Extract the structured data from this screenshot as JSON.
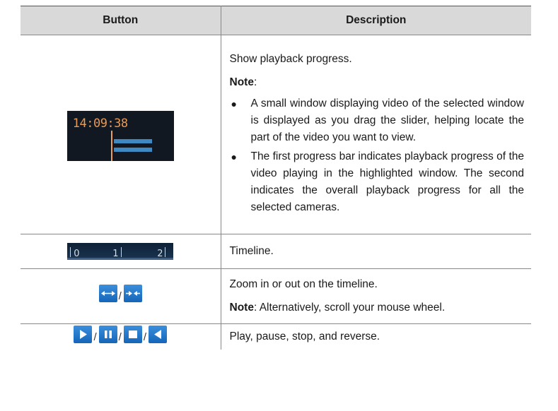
{
  "table": {
    "headers": [
      "Button",
      "Description"
    ],
    "rows": [
      {
        "image": {
          "time_text": "14:09:38"
        },
        "description": {
          "intro": "Show playback progress.",
          "note_label": "Note",
          "note_colon": ":",
          "bullets": [
            "A small window displaying video of the selected window is displayed as you drag the slider, helping locate the part of the video you want to view.",
            "The first progress bar indicates playback progress of the video playing in the highlighted window. The second indicates the overall playback progress for all the selected cameras."
          ]
        }
      },
      {
        "image": {
          "tick_labels": [
            "0",
            "1",
            "2"
          ]
        },
        "description": {
          "text": "Timeline."
        }
      },
      {
        "image": {
          "icons": [
            "zoom-in-icon",
            "zoom-out-icon"
          ],
          "separator": "/"
        },
        "description": {
          "text": "Zoom in or out on the timeline.",
          "note_label": "Note",
          "note_text": ": Alternatively, scroll your mouse wheel."
        }
      },
      {
        "image": {
          "icons": [
            "play-icon",
            "pause-icon",
            "stop-icon",
            "reverse-icon"
          ],
          "separator": "/"
        },
        "description": {
          "text": "Play, pause, stop, and reverse."
        }
      }
    ]
  },
  "colors": {
    "header_bg": "#d9d9d9",
    "icon_button_blue": "#2a7fd0",
    "timestamp_orange": "#e69a55",
    "progress_bar_blue": "#3f89c3"
  }
}
